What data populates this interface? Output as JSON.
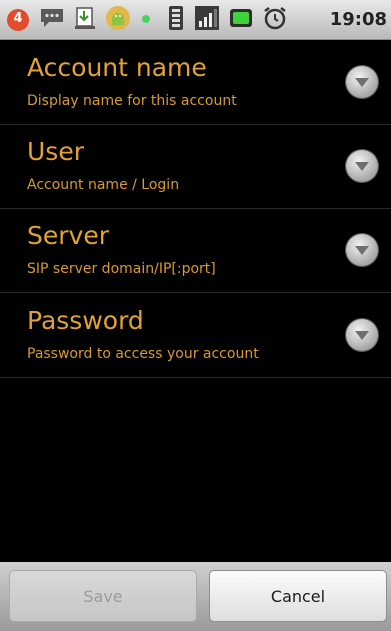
{
  "status_bar": {
    "time": "19:08",
    "notification_count": "4",
    "icons": [
      "notification-badge-icon",
      "chat-icon",
      "download-icon",
      "android-icon",
      "dot-icon",
      "sim-icon",
      "signal-icon",
      "battery-icon",
      "alarm-icon"
    ]
  },
  "preferences": [
    {
      "title": "Account name",
      "summary": "Display name for this account"
    },
    {
      "title": "User",
      "summary": "Account name / Login"
    },
    {
      "title": "Server",
      "summary": "SIP server domain/IP[:port]"
    },
    {
      "title": "Password",
      "summary": "Password to access your account"
    }
  ],
  "buttons": {
    "save_label": "Save",
    "cancel_label": "Cancel"
  },
  "colors": {
    "accent": "#e3a233",
    "background": "#000000"
  }
}
